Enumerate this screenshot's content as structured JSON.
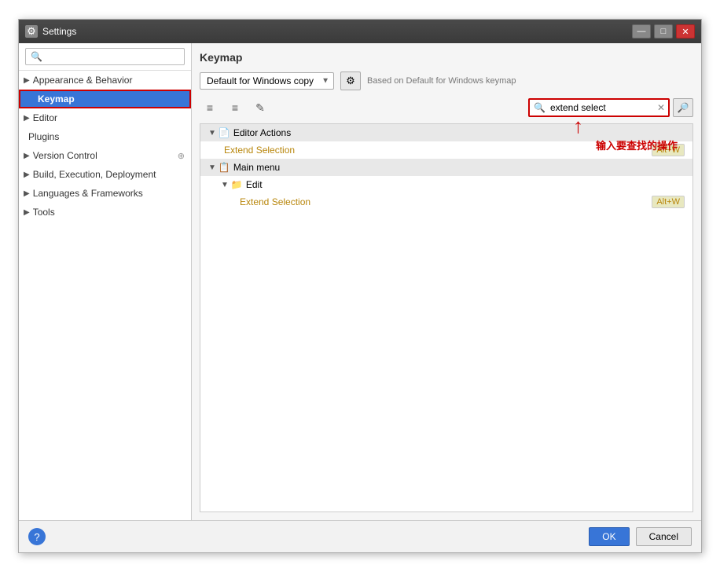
{
  "window": {
    "title": "Settings",
    "titlebar_icon": "⚙"
  },
  "sidebar": {
    "search_placeholder": "🔍",
    "items": [
      {
        "id": "appearance",
        "label": "Appearance & Behavior",
        "level": 0,
        "has_arrow": true,
        "active": false
      },
      {
        "id": "keymap",
        "label": "Keymap",
        "level": 1,
        "has_arrow": false,
        "active": true
      },
      {
        "id": "editor",
        "label": "Editor",
        "level": 0,
        "has_arrow": true,
        "active": false
      },
      {
        "id": "plugins",
        "label": "Plugins",
        "level": 0,
        "has_arrow": false,
        "active": false
      },
      {
        "id": "version-control",
        "label": "Version Control",
        "level": 0,
        "has_arrow": true,
        "active": false
      },
      {
        "id": "build",
        "label": "Build, Execution, Deployment",
        "level": 0,
        "has_arrow": true,
        "active": false
      },
      {
        "id": "languages",
        "label": "Languages & Frameworks",
        "level": 0,
        "has_arrow": true,
        "active": false
      },
      {
        "id": "tools",
        "label": "Tools",
        "level": 0,
        "has_arrow": true,
        "active": false
      }
    ]
  },
  "keymap": {
    "title": "Keymap",
    "dropdown_value": "Default for Windows copy",
    "based_on": "Based on Default for Windows keymap",
    "search_value": "extend select",
    "search_placeholder": "extend select",
    "toolbar": {
      "indent_icon": "≡",
      "outdent_icon": "≡",
      "edit_icon": "✎"
    }
  },
  "tree": {
    "sections": [
      {
        "id": "editor-actions",
        "label": "Editor Actions",
        "icon": "📄",
        "expanded": true,
        "items": [
          {
            "id": "extend-selection-1",
            "label": "Extend Selection",
            "shortcut": "Alt+W",
            "highlight": true
          }
        ]
      },
      {
        "id": "main-menu",
        "label": "Main menu",
        "icon": "📋",
        "expanded": true,
        "items": [
          {
            "id": "edit-group",
            "label": "Edit",
            "icon": "📁",
            "expanded": true,
            "items": [
              {
                "id": "extend-selection-2",
                "label": "Extend Selection",
                "shortcut": "Alt+W",
                "highlight": true
              }
            ]
          }
        ]
      }
    ]
  },
  "annotation": {
    "text": "输入要查找的操作"
  },
  "bottom": {
    "ok_label": "OK",
    "cancel_label": "Cancel",
    "help_icon": "?"
  }
}
